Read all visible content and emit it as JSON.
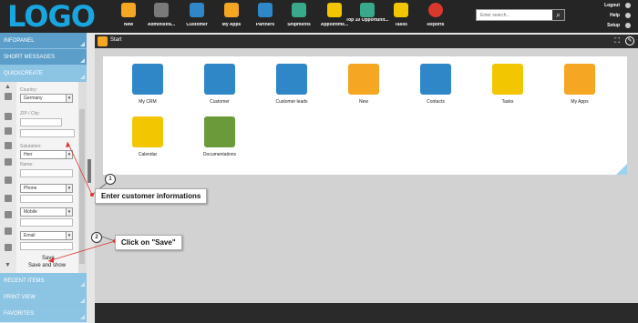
{
  "brand": {
    "logo_text": "LOGO"
  },
  "nav": [
    {
      "label": "New",
      "icon": "new-icon",
      "color": "#f5a623"
    },
    {
      "label": "Administra...",
      "icon": "wrench-icon",
      "color": "#7a7a7a"
    },
    {
      "label": "Customer",
      "icon": "customer-icon",
      "color": "#2f87c8"
    },
    {
      "label": "My Apps",
      "icon": "apps-icon",
      "color": "#f5a623"
    },
    {
      "label": "Partners",
      "icon": "partners-icon",
      "color": "#2f87c8"
    },
    {
      "label": "Shipments",
      "icon": "box-icon",
      "color": "#3aa88a"
    },
    {
      "label": "Appointme...",
      "icon": "calendar-icon",
      "color": "#f2c600"
    },
    {
      "label": "Top 10 Opportunit...",
      "icon": "chart-icon",
      "color": "#3aa88a"
    },
    {
      "label": "Tasks",
      "icon": "tasks-icon",
      "color": "#f2c600"
    },
    {
      "label": "Reports",
      "icon": "reports-icon",
      "color": "#d9382f"
    }
  ],
  "search": {
    "placeholder": "Enter search..."
  },
  "toplinks": {
    "logout": "Logout",
    "help": "Help",
    "setup": "Setup"
  },
  "sidebar": {
    "infopanel": "INFOPANEL",
    "short_messages": "SHORT MESSAGES",
    "quickcreate": "QUICKCREATE",
    "recent_items": "RECENT ITEMS",
    "print_view": "PRINT VIEW",
    "favorites": "FAVORITES"
  },
  "form": {
    "country_label": "Country:",
    "country_value": "Germany",
    "zip_label": "ZIP / City:",
    "salutation_label": "Salutation:",
    "salutation_value": "Herr",
    "name_label": "Name:",
    "phone_value": "Phone",
    "mobile_value": "Mobile",
    "email_value": "Email",
    "save_label": "Save",
    "save_show_label": "Save and show"
  },
  "main": {
    "title": "Start",
    "tiles": [
      {
        "label": "My CRM",
        "color": "#2f87c8"
      },
      {
        "label": "Customer",
        "color": "#2f87c8"
      },
      {
        "label": "Customer leads",
        "color": "#2f87c8"
      },
      {
        "label": "New",
        "color": "#f5a623"
      },
      {
        "label": "Contacts",
        "color": "#2f87c8"
      },
      {
        "label": "Tasks",
        "color": "#f2c600"
      },
      {
        "label": "My Apps",
        "color": "#f5a623"
      },
      {
        "label": "Calendar",
        "color": "#f2c600"
      },
      {
        "label": "Documentations",
        "color": "#6a9a3a"
      }
    ]
  },
  "callouts": {
    "step1_num": "1",
    "step1_text": "Enter customer informations",
    "step2_num": "2",
    "step2_text": "Click on \"Save\""
  }
}
